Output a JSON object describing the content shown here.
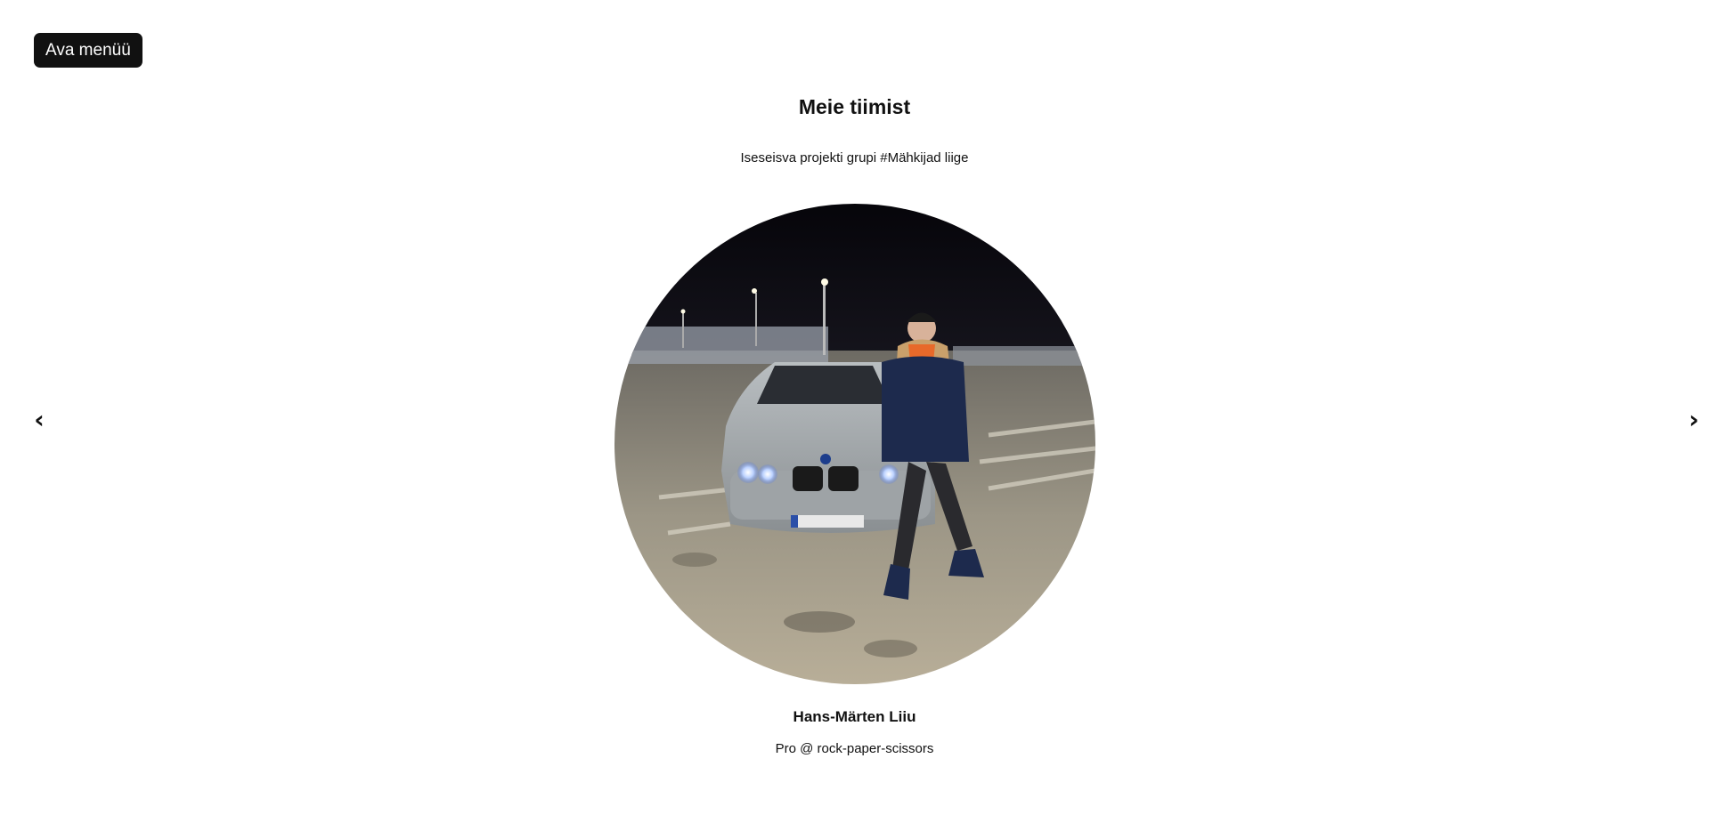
{
  "menu": {
    "open_label": "Ava menüü"
  },
  "page": {
    "title": "Meie tiimist",
    "subtitle": "Iseseisva projekti grupi #Mähkijad liige"
  },
  "carousel": {
    "prev_label": "‹",
    "next_label": "›",
    "member": {
      "name": "Hans-Märten Liiu",
      "role": "Pro @ rock-paper-scissors"
    }
  }
}
